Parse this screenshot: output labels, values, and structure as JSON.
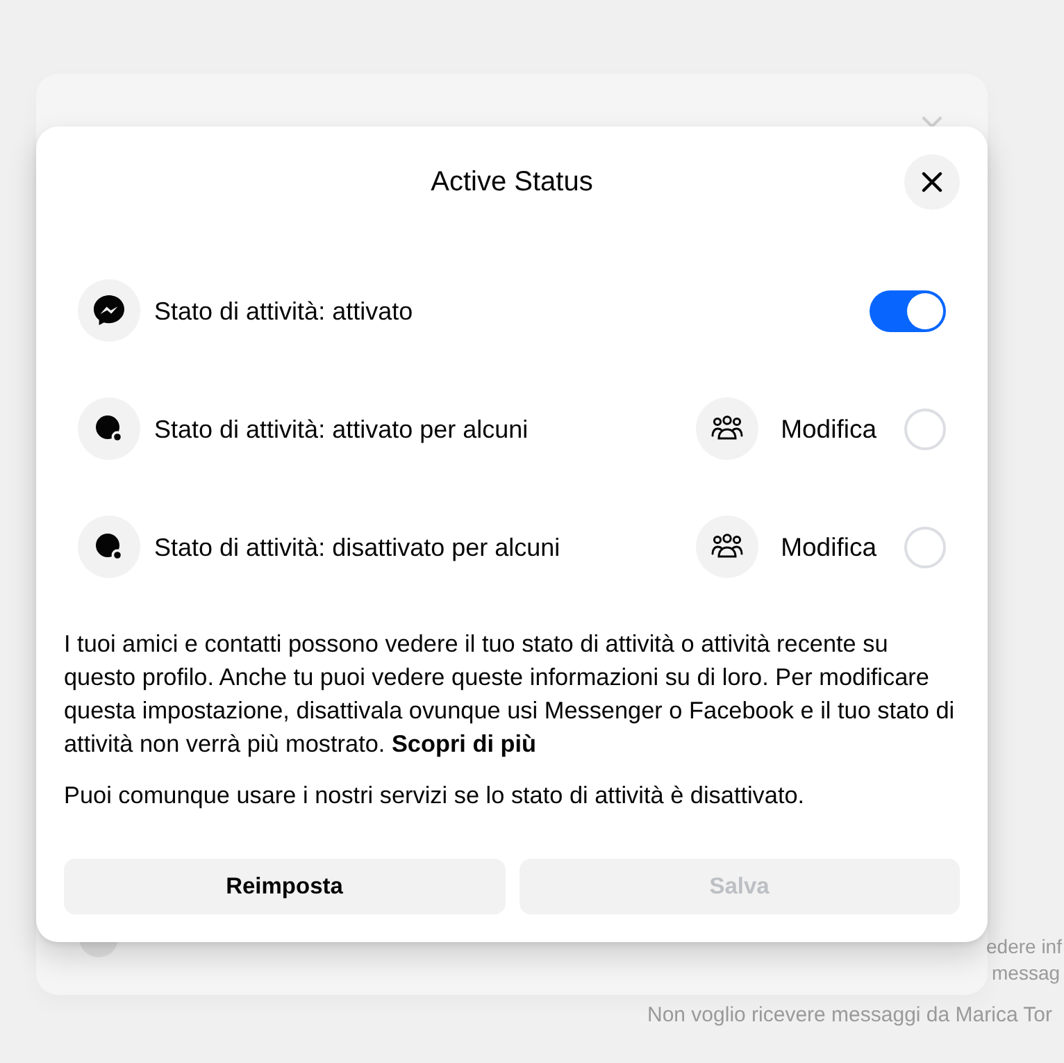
{
  "background_page": {
    "side_lines": [
      "edere inf",
      "messag"
    ],
    "footer_text": "Non voglio ricevere messaggi da Marica Tor"
  },
  "dialog": {
    "title": "Active Status"
  },
  "options": [
    {
      "kind": "toggle",
      "label": "Stato di attività: attivato",
      "on": true
    },
    {
      "kind": "radio",
      "label": "Stato di attività: attivato per alcuni",
      "action": "Modifica",
      "selected": false
    },
    {
      "kind": "radio",
      "label": "Stato di attività: disattivato per alcuni",
      "action": "Modifica",
      "selected": false
    }
  ],
  "description": {
    "text": "I tuoi amici e contatti possono vedere il tuo stato di attività o attività recente su questo profilo. Anche tu puoi vedere queste informazioni su di loro. Per modificare questa impostazione, disattivala ovunque usi Messenger o Facebook e il tuo stato di attività non verrà più mostrato.",
    "link": "Scopri di più"
  },
  "note": "Puoi comunque usare i nostri servizi se lo stato di attività è disattivato.",
  "buttons": [
    {
      "label": "Reimposta",
      "disabled": false
    },
    {
      "label": "Salva",
      "disabled": true
    }
  ]
}
